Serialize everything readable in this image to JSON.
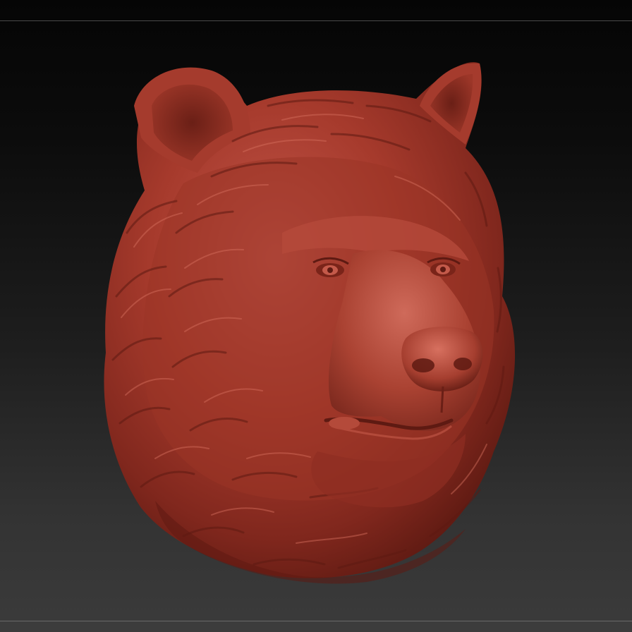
{
  "viewport": {
    "background_top": "#050505",
    "background_bottom": "#3b3b3b",
    "frame_line_color": "#4a4a4a"
  },
  "model": {
    "subject": "bear-head-sculpt",
    "material_color": "#a63a2c",
    "shadow_color": "#5e1a12",
    "highlight_color": "#d7705f"
  }
}
